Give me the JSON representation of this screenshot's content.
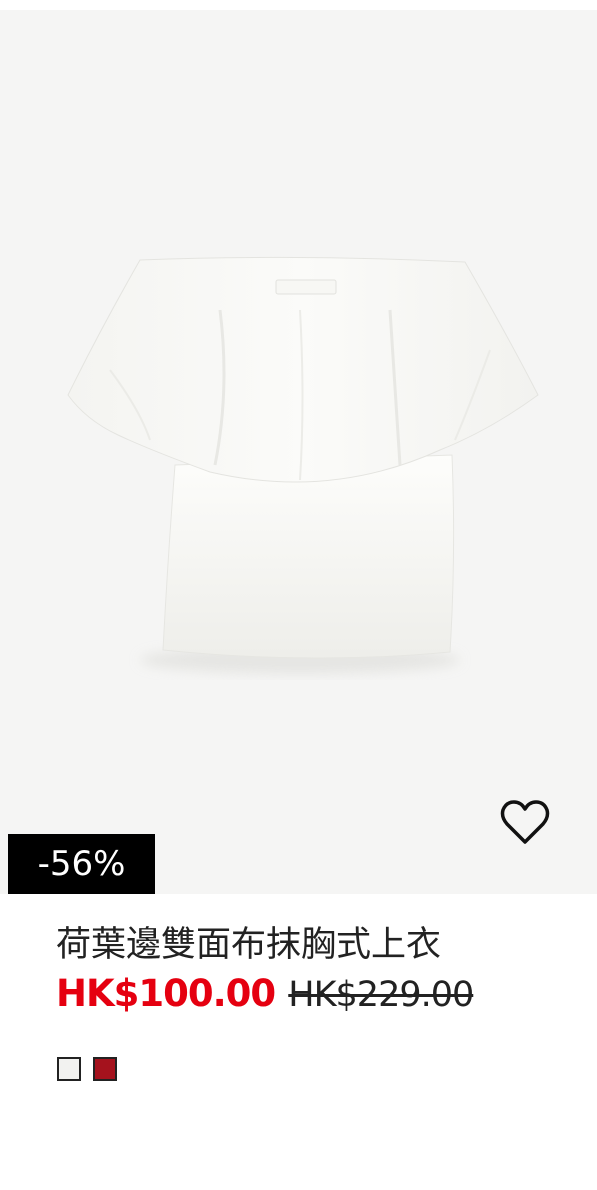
{
  "product": {
    "discount_badge": "-56%",
    "title": "荷葉邊雙面布抹胸式上衣",
    "sale_price": "HK$100.00",
    "original_price": "HK$229.00",
    "favorite_icon": "heart-outline-icon",
    "image_alt": "White off-shoulder ruffle top",
    "swatches": [
      {
        "color": "#f2f2f0"
      },
      {
        "color": "#a5121d"
      }
    ]
  },
  "colors": {
    "sale_price": "#e50010",
    "badge_bg": "#000000",
    "image_bg": "#f5f5f4"
  }
}
